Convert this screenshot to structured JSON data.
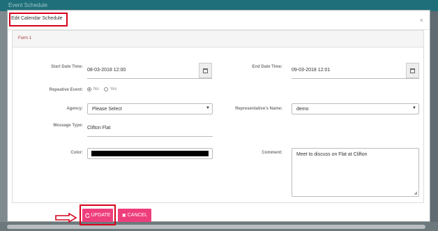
{
  "background": {
    "title": "Event Schedule"
  },
  "modal": {
    "title": "Edit Calendar Schedule",
    "close_glyph": "×",
    "panel_title": "Form 1"
  },
  "form": {
    "start_label": "Start Date Time:",
    "start_value": "08-03-2018 12:00",
    "end_label": "End Date Time:",
    "end_value": "09-03-2018 12:01",
    "repeative_label": "Repeative Event:",
    "repeative_options": [
      "No",
      "Yes"
    ],
    "repeative_selected": "No",
    "agency_label": "Agency:",
    "agency_value": "Please Select",
    "rep_label": "Representative's Name:",
    "rep_value": "demo",
    "message_label": "Message Type:",
    "message_value": "Clifton Flat",
    "color_label": "Color:",
    "color_value": "#000000",
    "comment_label": "Comment:",
    "comment_value": "Meet to discuss on Flat at Clifton"
  },
  "buttons": {
    "update_label": "UPDATE",
    "update_icon": "refresh-icon",
    "cancel_label": "CANCEL",
    "cancel_icon": "close-icon"
  },
  "colors": {
    "accent": "#ee3e7b",
    "highlight": "#d6001c",
    "topbar": "#1f6f7a"
  }
}
